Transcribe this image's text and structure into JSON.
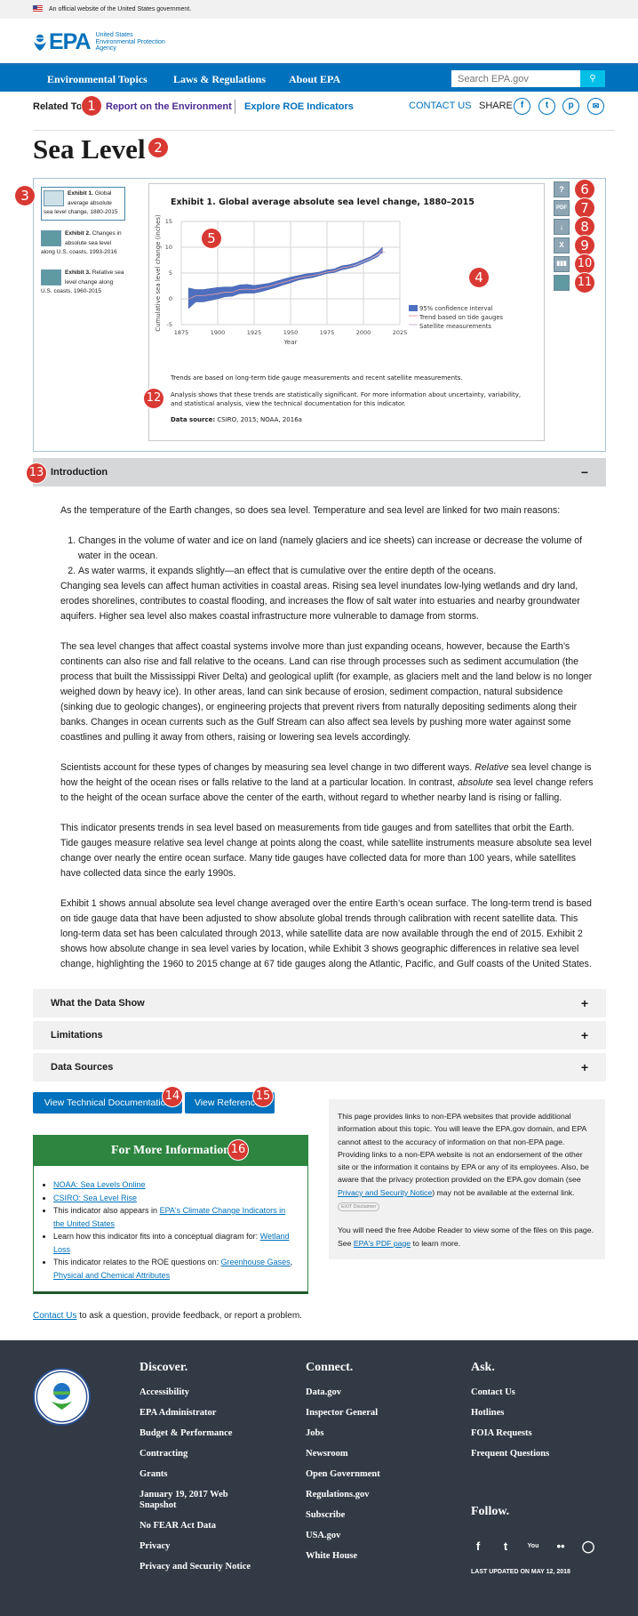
{
  "gov_banner": {
    "text": "An official website of the United States government."
  },
  "header": {
    "logo_text": "EPA",
    "agency_lines": [
      "United States",
      "Environmental Protection",
      "Agency"
    ]
  },
  "nav": {
    "items": [
      "Environmental Topics",
      "Laws & Regulations",
      "About EPA"
    ],
    "search_placeholder": "Search EPA.gov",
    "search_icon": "search-icon"
  },
  "subheader": {
    "related_label": "Related Topics:",
    "related_visible": "Related Top",
    "links": [
      "Report on the Environment",
      "Explore ROE Indicators"
    ],
    "contact_us": "CONTACT US",
    "share_label": "SHARE",
    "share_icons": [
      "facebook-icon",
      "twitter-icon",
      "pinterest-icon",
      "email-icon"
    ]
  },
  "page": {
    "title": "Sea Level"
  },
  "exhibits": {
    "thumbs": [
      {
        "bold": "Exhibit 1.",
        "text": " Global average absolute sea level change, 1880-2015",
        "icon": "line-chart-icon",
        "active": true
      },
      {
        "bold": "Exhibit 2.",
        "text": " Changes in absolute sea level along U.S. coasts, 1993-2016",
        "icon": "us-map-icon",
        "active": false
      },
      {
        "bold": "Exhibit 3.",
        "text": " Relative sea level change along U.S. coasts, 1960-2015",
        "icon": "us-map-icon",
        "active": false
      }
    ],
    "tools": [
      "help-icon",
      "pdf-icon",
      "download-icon",
      "excel-icon",
      "chart-data-icon",
      "map-icon"
    ],
    "notes": {
      "trend": "Trends are based on long-term tide gauge measurements and recent satellite measurements.",
      "analysis": "Analysis shows that these trends are statistically significant. For more information about uncertainty, variability, and statistical analysis, view the technical documentation for this indicator.",
      "source_label": "Data source:",
      "source_text": " CSIRO, 2015; NOAA, 2016a"
    }
  },
  "chart_data": {
    "type": "area",
    "title": "Exhibit 1. Global average absolute sea level change, 1880–2015",
    "xlabel": "Year",
    "ylabel": "Cumulative sea level change (inches)",
    "xlim": [
      1875,
      2025
    ],
    "ylim": [
      -5,
      15
    ],
    "xticks": [
      1875,
      1900,
      1925,
      1950,
      1975,
      2000,
      2025
    ],
    "yticks": [
      -5,
      0,
      5,
      10,
      15
    ],
    "grid": true,
    "legend_position": "right",
    "legend": [
      "95% confidence interval",
      "Trend based on tide gauges",
      "Satellite measurements"
    ],
    "series": [
      {
        "name": "Trend based on tide gauges",
        "x": [
          1880,
          1885,
          1890,
          1895,
          1900,
          1905,
          1910,
          1915,
          1920,
          1925,
          1930,
          1935,
          1940,
          1945,
          1950,
          1955,
          1960,
          1965,
          1970,
          1975,
          1980,
          1985,
          1990,
          1995,
          2000,
          2005,
          2010,
          2013
        ],
        "values": [
          0.0,
          0.6,
          0.6,
          0.8,
          1.0,
          1.3,
          1.3,
          1.8,
          1.9,
          1.8,
          2.1,
          2.4,
          2.8,
          3.2,
          3.6,
          4.0,
          4.3,
          4.5,
          4.8,
          5.2,
          5.4,
          6.0,
          6.2,
          6.6,
          7.2,
          7.8,
          8.6,
          9.5
        ]
      },
      {
        "name": "95% confidence interval",
        "x": [
          1880,
          1885,
          1890,
          1895,
          1900,
          1905,
          1910,
          1915,
          1920,
          1925,
          1930,
          1935,
          1940,
          1945,
          1950,
          1955,
          1960,
          1965,
          1970,
          1975,
          1980,
          1985,
          1990,
          1995,
          2000,
          2005,
          2010,
          2013
        ],
        "lower": [
          -1.9,
          -0.6,
          -0.6,
          -0.3,
          0.0,
          0.4,
          0.5,
          1.0,
          1.1,
          1.1,
          1.4,
          1.8,
          2.2,
          2.7,
          3.1,
          3.6,
          3.9,
          4.1,
          4.5,
          4.9,
          5.1,
          5.6,
          5.9,
          6.3,
          6.9,
          7.5,
          8.2,
          9.0
        ],
        "upper": [
          2.1,
          1.8,
          1.8,
          2.0,
          2.2,
          2.3,
          2.3,
          2.7,
          2.8,
          2.6,
          2.8,
          3.0,
          3.4,
          3.8,
          4.2,
          4.5,
          4.8,
          5.0,
          5.2,
          5.6,
          5.8,
          6.4,
          6.6,
          7.0,
          7.6,
          8.2,
          9.1,
          10.0
        ]
      },
      {
        "name": "Satellite measurements",
        "x": [
          1993,
          1995,
          2000,
          2005,
          2010,
          2015
        ],
        "values": [
          6.4,
          6.6,
          7.2,
          7.8,
          8.5,
          9.1
        ]
      }
    ]
  },
  "accordions": [
    {
      "label": "Introduction",
      "state": "−"
    },
    {
      "label": "What the Data Show",
      "state": "+"
    },
    {
      "label": "Limitations",
      "state": "+"
    },
    {
      "label": "Data Sources",
      "state": "+"
    }
  ],
  "intro": {
    "lead": "As the temperature of the Earth changes, so does sea level. Temperature and sea level are linked for two main reasons:",
    "list": [
      "Changes in the volume of water and ice on land (namely glaciers and ice sheets) can increase or decrease the volume of water in the ocean.",
      "As water warms, it expands slightly—an effect that is cumulative over the entire depth of the oceans."
    ],
    "p1": "Changing sea levels can affect human activities in coastal areas. Rising sea level inundates low-lying wetlands and dry land, erodes shorelines, contributes to coastal flooding, and increases the flow of salt water into estuaries and nearby groundwater aquifers. Higher sea level also makes coastal infrastructure more vulnerable to damage from storms.",
    "p2": "The sea level changes that affect coastal systems involve more than just expanding oceans, however, because the Earth’s continents can also rise and fall relative to the oceans. Land can rise through processes such as sediment accumulation (the process that built the Mississippi River Delta) and geological uplift (for example, as glaciers melt and the land below is no longer weighed down by heavy ice). In other areas, land can sink because of erosion, sediment compaction, natural subsidence (sinking due to geologic changes), or engineering projects that prevent rivers from naturally depositing sediments along their banks. Changes in ocean currents such as the Gulf Stream can also affect sea levels by pushing more water against some coastlines and pulling it away from others, raising or lowering sea levels accordingly.",
    "p3_a": "Scientists account for these types of changes by measuring sea level change in two different ways. ",
    "p3_em1": "Relative",
    "p3_b": " sea level change is how the height of the ocean rises or falls relative to the land at a particular location. In contrast, ",
    "p3_em2": "absolute",
    "p3_c": " sea level change refers to the height of the ocean surface above the center of the earth, without regard to whether nearby land is rising or falling.",
    "p4": "This indicator presents trends in sea level based on measurements from tide gauges and from satellites that orbit the Earth. Tide gauges measure relative sea level change at points along the coast, while satellite instruments measure absolute sea level change over nearly the entire ocean surface. Many tide gauges have collected data for more than 100 years, while satellites have collected data since the early 1990s.",
    "p5": "Exhibit 1 shows annual absolute sea level change averaged over the entire Earth’s ocean surface. The long-term trend is based on tide gauge data that have been adjusted to show absolute global trends through calibration with recent satellite data. This long-term data set has been calculated through 2013, while satellite data are now available through the end of 2015. Exhibit 2 shows how absolute change in sea level varies by location, while Exhibit 3 shows geographic differences in relative sea level change, highlighting the 1960 to 2015 change at 67 tide gauges along the Atlantic, Pacific, and Gulf coasts of the United States."
  },
  "buttons": {
    "tech_doc": "View Technical Documentation",
    "references": "View References"
  },
  "more_info": {
    "title": "For More Information",
    "link1": "NOAA: Sea Levels Online",
    "link2": "CSIRO: Sea Level Rise",
    "item3_text": "This indicator also appears in ",
    "item3_link": "EPA's Climate Change Indicators in the United States",
    "item4_text": "Learn how this indicator fits into a conceptual diagram for: ",
    "item4_link": "Wetland Loss",
    "item5_text": "This indicator relates to the ROE questions on: ",
    "item5_link1": "Greenhouse Gases",
    "item5_sep": ", ",
    "item5_link2": "Physical and Chemical Attributes"
  },
  "disclaimer": {
    "p1_a": "This page provides links to non-EPA websites that provide additional information about this topic. You will leave the EPA.gov domain, and EPA cannot attest to the accuracy of information on that non-EPA page. Providing links to a non-EPA website is not an endorsement of the other site or the information it contains by EPA or any of its employees. Also, be aware that the privacy protection provided on the EPA.gov domain (see ",
    "p1_link": "Privacy and Security Notice",
    "p1_b": ") may not be available at the external link. ",
    "exit_badge": "EXIT Disclaimer",
    "p2_a": "You will need the free Adobe Reader to view some of the files on this page. See ",
    "p2_link": "EPA's PDF page",
    "p2_b": " to learn more."
  },
  "contact_line": {
    "link": "Contact Us",
    "text": " to ask a question, provide feedback, or report a problem."
  },
  "footer": {
    "discover": {
      "title": "Discover.",
      "links": [
        "Accessibility",
        "EPA Administrator",
        "Budget & Performance",
        "Contracting",
        "Grants",
        "January 19, 2017 Web Snapshot",
        "No FEAR Act Data",
        "Privacy",
        "Privacy and Security Notice"
      ]
    },
    "connect": {
      "title": "Connect.",
      "links": [
        "Data.gov",
        "Inspector General",
        "Jobs",
        "Newsroom",
        "Open Government",
        "Regulations.gov",
        "Subscribe",
        "USA.gov",
        "White House"
      ]
    },
    "ask": {
      "title": "Ask.",
      "links": [
        "Contact Us",
        "Hotlines",
        "FOIA Requests",
        "Frequent Questions"
      ]
    },
    "follow": {
      "title": "Follow.",
      "icons": [
        "facebook-icon",
        "twitter-icon",
        "youtube-icon",
        "flickr-icon",
        "instagram-icon"
      ]
    },
    "last_updated": "LAST UPDATED ON MAY 12, 2018"
  },
  "annotations": [
    "1",
    "2",
    "3",
    "4",
    "5",
    "6",
    "7",
    "8",
    "9",
    "10",
    "11",
    "12",
    "13",
    "14",
    "15",
    "16"
  ]
}
